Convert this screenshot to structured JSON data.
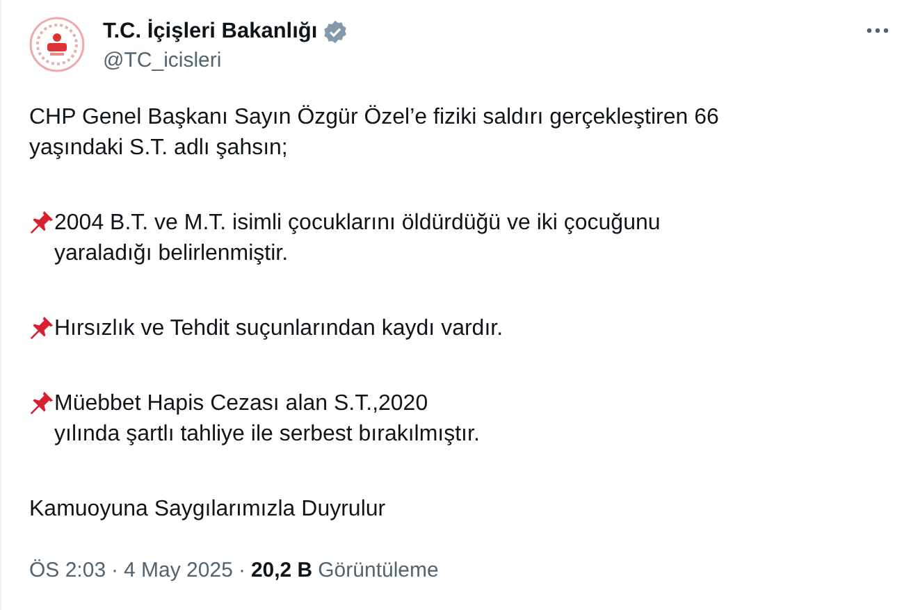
{
  "author": {
    "name": "T.C. İçişleri Bakanlığı",
    "verified": true,
    "handle": "@TC_icisleri"
  },
  "paragraphs": [
    {
      "pin": false,
      "text": "CHP Genel Başkanı Sayın Özgür Özel’e fiziki saldırı gerçekleştiren 66\nyaşındaki S.T. adlı şahsın;"
    },
    {
      "pin": true,
      "text": "2004 B.T. ve M.T. isimli çocuklarını öldürdüğü ve iki çocuğunu\nyaraladığı belirlenmiştir."
    },
    {
      "pin": true,
      "text": " Hırsızlık ve Tehdit suçunlarından kaydı vardır."
    },
    {
      "pin": true,
      "text": "Müebbet Hapis Cezası alan S.T.,2020\nyılında şartlı tahliye ile serbest bırakılmıştır."
    },
    {
      "pin": false,
      "text": "Kamuoyuna Saygılarımızla Duyrulur"
    }
  ],
  "footer": {
    "time": "ÖS 2:03",
    "separator_1": "·",
    "date": "4 May 2025",
    "separator_2": "·",
    "views": "20,2 B",
    "views_label": "Görüntüleme"
  }
}
